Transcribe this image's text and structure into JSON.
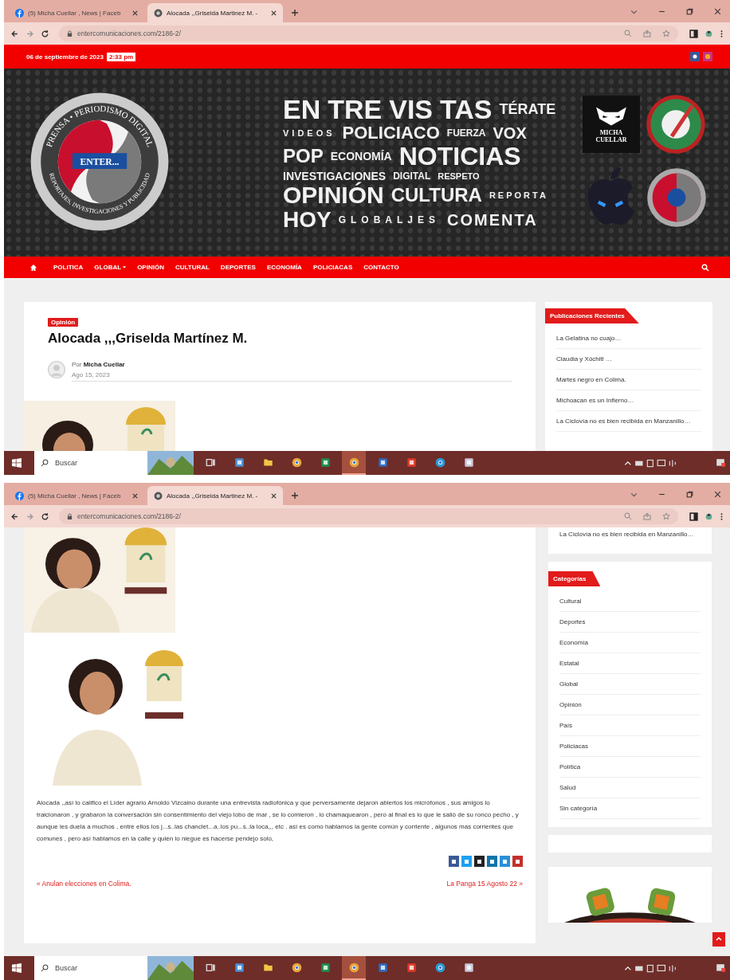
{
  "screens": [
    {
      "browser": {
        "tabs": [
          {
            "title": "(5) Micha Cuellar , News | Faceb",
            "selected": false
          },
          {
            "title": "Alocada ,,Griselda Martinez M. -",
            "selected": true
          }
        ],
        "url": "entercomunicaciones.com/2186-2/"
      },
      "page": {
        "kind": "top",
        "topbar": {
          "date": "06 de septiembre de 2023",
          "time": "2:33 pm"
        },
        "banner": {
          "logo_ring_top": "PRENSA • PERIODISMO DIGITAL",
          "logo_ring_bottom": "REPORTAJES, INVESTIGACIONES Y PUBLICIDAD",
          "logo_center": "ENTER...",
          "words": [
            "EN",
            "TRE",
            "VIS",
            "TAS",
            "TÉRATE",
            "VIDEOS",
            "POLICIACO",
            "FUERZA",
            "VOX",
            "POP",
            "ECONOMÍA",
            "NOTICIAS",
            "INVESTIGACIONES",
            "DIGITAL",
            "RESPETO",
            "OPINIÓN",
            "CULTURA",
            "REPORTA",
            "HOY",
            "GLOBALJES",
            "COMENTA"
          ],
          "mask_caption": "MICHA CUELLAR"
        },
        "nav": [
          {
            "label": "POLITICA",
            "dropdown": false
          },
          {
            "label": "GLOBAL",
            "dropdown": true
          },
          {
            "label": "OPINIÓN",
            "dropdown": false
          },
          {
            "label": "CULTURAL",
            "dropdown": false
          },
          {
            "label": "DEPORTES",
            "dropdown": false
          },
          {
            "label": "ECONOMÍA",
            "dropdown": false
          },
          {
            "label": "POLICIACAS",
            "dropdown": false
          },
          {
            "label": "CONTACTO",
            "dropdown": false
          }
        ],
        "article": {
          "category": "Opinión",
          "title": "Alocada ,,,Griselda Martínez M.",
          "author_prefix": "Por",
          "author": "Micha Cuellar",
          "date": "Ago 15, 2023"
        },
        "sidebar": {
          "title": "Publicaciones Recientes",
          "items": [
            "La Gelatina no cuajo…",
            "Claudia y Xóchitl …",
            "Martes negro en Colima.",
            "Michoacan es un Infierno…",
            "La Ciclovía no es bien recibida en Manzanillo…"
          ]
        }
      },
      "taskbar": {
        "search_placeholder": "Buscar",
        "apps": [
          {
            "kind": "taskview",
            "active": false
          },
          {
            "kind": "calc",
            "active": false
          },
          {
            "kind": "folder",
            "active": false
          },
          {
            "kind": "chrome",
            "active": false
          },
          {
            "kind": "excel",
            "active": false
          },
          {
            "kind": "chrome",
            "active": true
          },
          {
            "kind": "word",
            "active": false
          },
          {
            "kind": "pdf",
            "active": false
          },
          {
            "kind": "edge",
            "active": false
          },
          {
            "kind": "tool",
            "active": false
          }
        ]
      }
    },
    {
      "browser": {
        "tabs": [
          {
            "title": "(5) Micha Cuellar , News | Faceb",
            "selected": false
          },
          {
            "title": "Alocada ,,Griselda Martinez M. -",
            "selected": true
          }
        ],
        "url": "entercomunicaciones.com/2186-2/"
      },
      "page": {
        "kind": "scrolled",
        "article": {
          "paragraph": "Alocada ,,así lo califico el Líder agrario Arnoldo Vizcaino durante una entrevista radiofónica y que perversamente dejaron abiertos los micrófonos , sus amigos lo traicionaron , y grabaron la conversación sin consentimiento del viejo lobo de mar , se lo comieron , lo chamaquearon , pero al final es lo que le salió de su ronco pecho , y aunque les duela a muchos , entre ellos los j...s..las chanclet...a..los pu...s..la loca,,, etc . así es como hablamos la gente común y corriente , algunos mas corrientes que comunes , pero así hablamos en la calle y quien lo niegue es hacerse pendejo solo,",
          "share": [
            {
              "color": "#3b5998"
            },
            {
              "color": "#1da1f2"
            },
            {
              "color": "#222222"
            },
            {
              "color": "#0e76a8"
            },
            {
              "color": "#2a8fd8"
            },
            {
              "color": "#c4302b"
            }
          ],
          "prev": "« Anulan elecciones en Colima.",
          "next": "La Panga 15 Agosto 22 »"
        },
        "sidebar": {
          "last_recent": "La Ciclovía no es bien recibida en Manzanillo…",
          "categories_title": "Categorías",
          "categories": [
            "Cultural",
            "Deportes",
            "Economía",
            "Estatal",
            "Global",
            "Opinión",
            "País",
            "Policiacas",
            "Política",
            "Salud",
            "Sin categoría"
          ]
        }
      },
      "taskbar": {
        "search_placeholder": "Buscar",
        "apps": [
          {
            "kind": "taskview",
            "active": false
          },
          {
            "kind": "calc",
            "active": false
          },
          {
            "kind": "folder",
            "active": false
          },
          {
            "kind": "chrome",
            "active": false
          },
          {
            "kind": "excel",
            "active": false
          },
          {
            "kind": "chrome",
            "active": true
          },
          {
            "kind": "word",
            "active": false
          },
          {
            "kind": "pdf",
            "active": false
          },
          {
            "kind": "edge",
            "active": false
          },
          {
            "kind": "tool",
            "active": false
          }
        ]
      }
    }
  ]
}
